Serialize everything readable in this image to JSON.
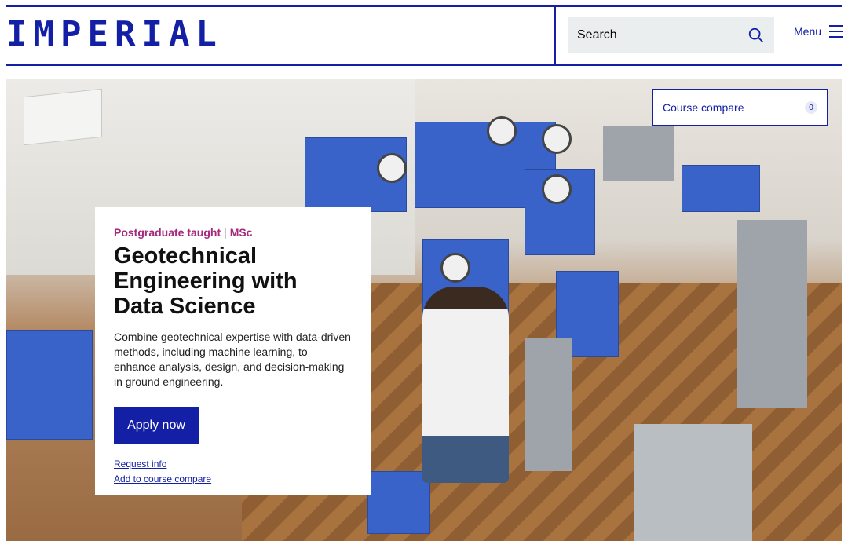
{
  "header": {
    "logo": "IMPERIAL",
    "search_label": "Search",
    "menu_label": "Menu"
  },
  "hero": {
    "compare": {
      "label": "Course compare",
      "count": "0"
    },
    "card": {
      "type": "Postgraduate taught",
      "separator": "|",
      "degree": "MSc",
      "title": "Geotechnical Engineering with Data Science",
      "description": "Combine geotechnical expertise with data-driven methods, including machine learning, to enhance analysis, design, and decision-making in ground engineering.",
      "apply_label": "Apply now",
      "request_info_label": "Request info",
      "add_compare_label": "Add to course compare"
    }
  },
  "colors": {
    "brand_blue": "#1320a6",
    "tag_magenta": "#a5297c",
    "search_bg": "#ebeeee"
  },
  "icons": [
    "search-icon",
    "menu-icon"
  ]
}
